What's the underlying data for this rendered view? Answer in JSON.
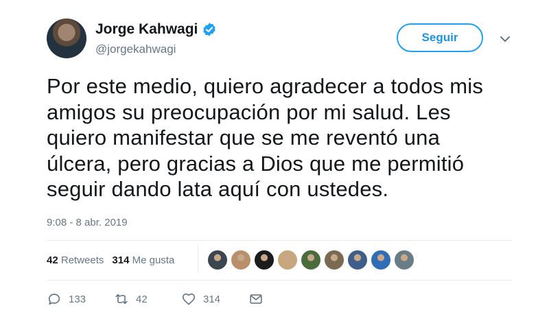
{
  "author": {
    "name": "Jorge Kahwagi",
    "handle": "@jorgekahwagi",
    "verified": true
  },
  "follow_label": "Seguir",
  "tweet": {
    "text": "Por este medio, quiero agradecer a todos mis\namigos su preocupación por mi salud. Les\nquiero manifestar que se me reventó una\núlcera, pero gracias a Dios que me permitió\nseguir dando lata aquí con ustedes.",
    "timestamp": "9:08 - 8 abr. 2019"
  },
  "stats": {
    "retweets_count": "42",
    "retweets_label": "Retweets",
    "likes_count": "314",
    "likes_label": "Me gusta"
  },
  "likers_avatar_colors": [
    "#3b4650",
    "#b8906a",
    "#1c1c1c",
    "#c9a77c",
    "#4a6b3a",
    "#7a6a52",
    "#3f5f8a",
    "#2f6db5",
    "#6a7d86"
  ],
  "actions": {
    "reply_count": "133",
    "retweet_count": "42",
    "like_count": "314"
  },
  "colors": {
    "accent": "#1da1f2",
    "secondary_text": "#657786"
  }
}
